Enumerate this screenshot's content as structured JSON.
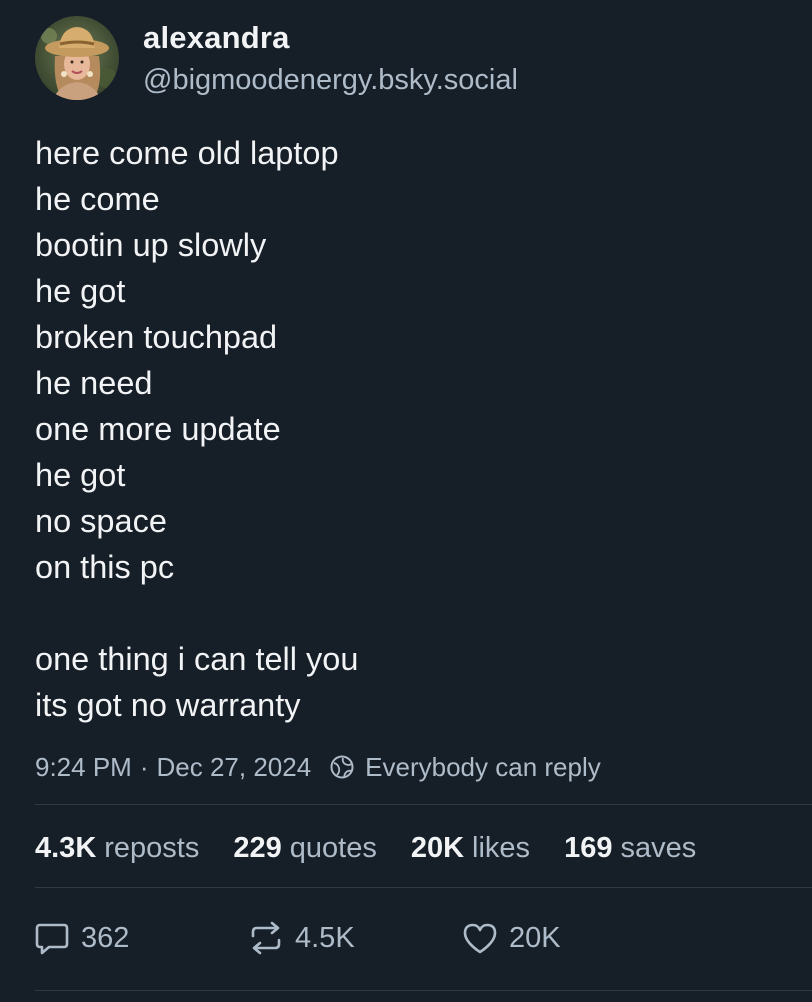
{
  "author": {
    "display_name": "alexandra",
    "handle": "@bigmoodenergy.bsky.social"
  },
  "post": {
    "lines": [
      "here come old laptop",
      "he come",
      "bootin up slowly",
      "he got",
      "broken touchpad",
      "he need",
      "one more update",
      "he got",
      "no space",
      "on this pc",
      "",
      "one thing i can tell you",
      "its got no warranty"
    ],
    "time": "9:24 PM",
    "separator": "·",
    "date": "Dec 27, 2024",
    "reply_setting": "Everybody can reply",
    "reply_setting_icon": "globe-icon"
  },
  "stats": {
    "reposts_count": "4.3K",
    "reposts_label": "reposts",
    "quotes_count": "229",
    "quotes_label": "quotes",
    "likes_count": "20K",
    "likes_label": "likes",
    "saves_count": "169",
    "saves_label": "saves"
  },
  "actions": {
    "reply": {
      "icon": "reply-bubble-icon",
      "count": "362"
    },
    "repost": {
      "icon": "repost-icon",
      "count": "4.5K"
    },
    "like": {
      "icon": "heart-icon",
      "count": "20K"
    }
  },
  "colors": {
    "background": "#161e27",
    "text_primary": "#f1f3f5",
    "text_secondary": "#aebbc9",
    "divider": "#2e3a48"
  }
}
